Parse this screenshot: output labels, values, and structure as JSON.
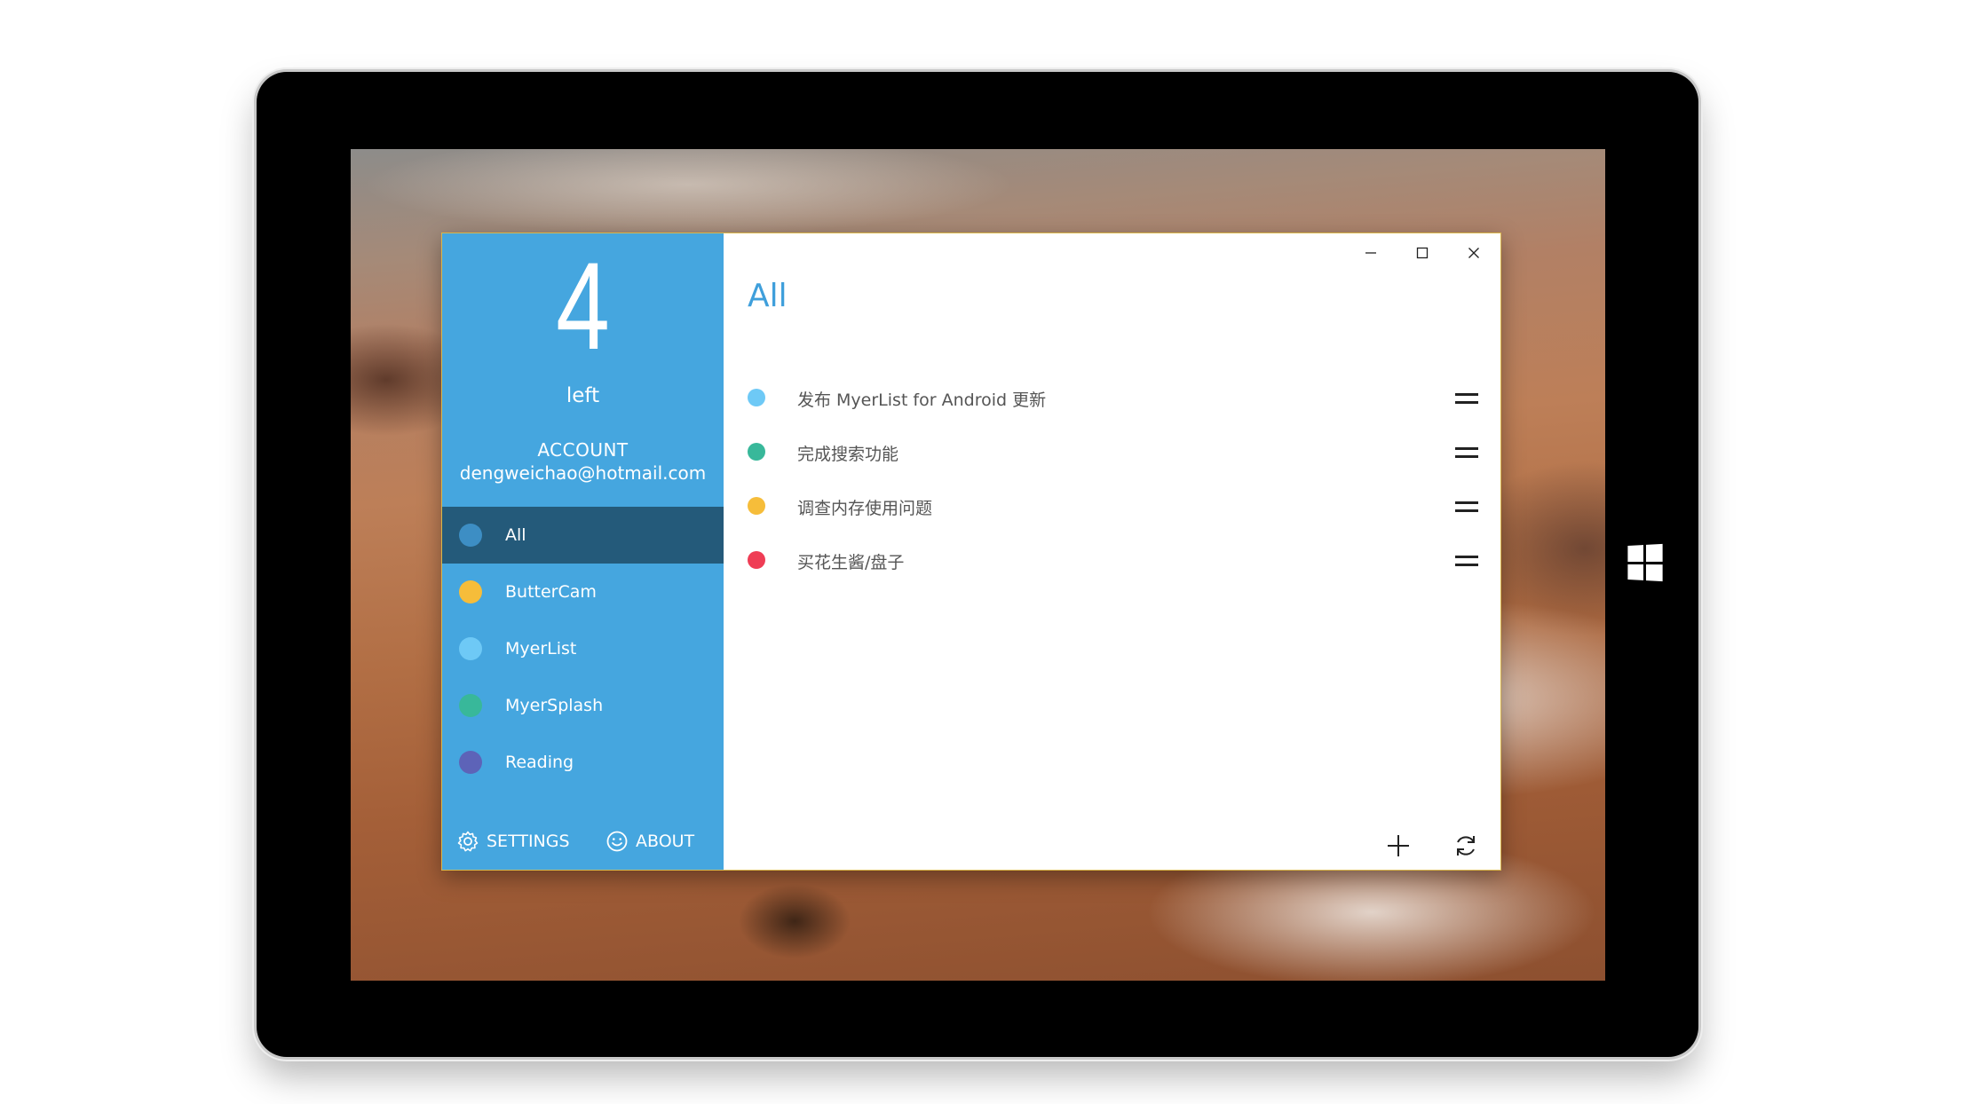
{
  "colors": {
    "sidebar_bg": "#45a6df",
    "sidebar_active": "#245a7a",
    "title_accent": "#3f9fdb",
    "window_border": "#d9b64a"
  },
  "sidebar": {
    "count": "4",
    "count_label": "left",
    "account_title": "ACCOUNT",
    "account_email": "dengweichao@hotmail.com",
    "categories": [
      {
        "label": "All",
        "color": "#3d8ec4",
        "active": true
      },
      {
        "label": "ButterCam",
        "color": "#f6bd3a",
        "active": false
      },
      {
        "label": "MyerList",
        "color": "#6ec9f6",
        "active": false
      },
      {
        "label": "MyerSplash",
        "color": "#38b89a",
        "active": false
      },
      {
        "label": "Reading",
        "color": "#5d63b8",
        "active": false
      }
    ],
    "settings_label": "SETTINGS",
    "settings_icon": "gear-icon",
    "about_label": "ABOUT",
    "about_icon": "smiley-icon"
  },
  "main": {
    "title": "All",
    "tasks": [
      {
        "text": "发布 MyerList for Android 更新",
        "color": "#6ec9f6"
      },
      {
        "text": "完成搜索功能",
        "color": "#38b89a"
      },
      {
        "text": "调查内存使用问题",
        "color": "#f6bd3a"
      },
      {
        "text": "买花生酱/盘子",
        "color": "#ef3d55"
      }
    ],
    "add_icon": "plus-icon",
    "sync_icon": "refresh-icon"
  },
  "window_controls": [
    "minimize-icon",
    "maximize-icon",
    "close-icon"
  ]
}
